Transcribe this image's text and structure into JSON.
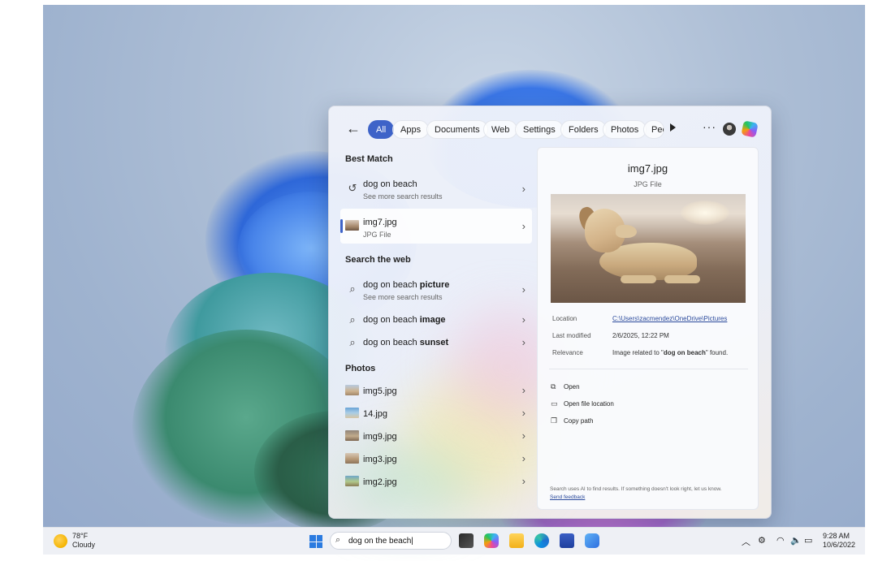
{
  "search_panel": {
    "tabs": [
      "All",
      "Apps",
      "Documents",
      "Web",
      "Settings",
      "Folders",
      "Photos",
      "Peo"
    ],
    "active_tab": "All",
    "best_match": {
      "header": "Best Match",
      "items": [
        {
          "title": "dog on beach",
          "subtitle": "See more search results",
          "icon": "history-icon"
        },
        {
          "title": "img7.jpg",
          "subtitle": "JPG File",
          "icon": "image-thumbnail"
        }
      ]
    },
    "web": {
      "header": "Search the web",
      "items": [
        {
          "title_prefix": "dog on beach ",
          "title_bold": "picture",
          "subtitle": "See more search results"
        },
        {
          "title_prefix": "dog on beach ",
          "title_bold": "image"
        },
        {
          "title_prefix": "dog on beach ",
          "title_bold": "sunset"
        }
      ]
    },
    "photos": {
      "header": "Photos",
      "items": [
        "img5.jpg",
        "14.jpg",
        "img9.jpg",
        "img3.jpg",
        "img2.jpg"
      ]
    },
    "preview": {
      "title": "img7.jpg",
      "type": "JPG File",
      "meta": {
        "location_label": "Location",
        "location_value": "C:\\Users\\zacmendez\\OneDrive\\Pictures",
        "modified_label": "Last modified",
        "modified_value": "2/6/2025, 12:22 PM",
        "relevance_label": "Relevance",
        "relevance_prefix": "Image related to \"",
        "relevance_bold": "dog on beach",
        "relevance_suffix": "\" found."
      },
      "actions": [
        "Open",
        "Open file location",
        "Copy path"
      ],
      "disclaimer": "Search uses AI to find results. If something doesn't look right, let us know.",
      "feedback": "Send feedback"
    }
  },
  "taskbar": {
    "weather_temp": "78°F",
    "weather_condition": "Cloudy",
    "search_query": "dog on the beach|",
    "time": "9:28 AM",
    "date": "10/6/2022"
  },
  "colors": {
    "accent": "#3e63c8",
    "link": "#2b4a9c"
  }
}
